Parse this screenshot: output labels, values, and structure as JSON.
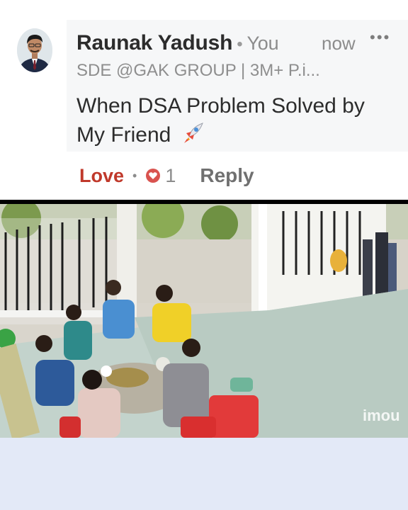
{
  "comment": {
    "author": "Raunak Yadush",
    "relation": "You",
    "time": "now",
    "more_icon": "more-horizontal-icon",
    "headline": "SDE @GAK GROUP | 3M+ P.i...",
    "text": "When DSA Problem Solved by My Friend",
    "emoji_icon": "rocket-icon"
  },
  "actions": {
    "reaction_label": "Love",
    "reaction_icon": "heart-reaction-icon",
    "reaction_count": "1",
    "reply_label": "Reply"
  },
  "video": {
    "watermark": "imou"
  },
  "colors": {
    "love": "#c0392b",
    "bubble_bg": "#f6f7f8",
    "footer_bg": "#e3e9f7"
  }
}
